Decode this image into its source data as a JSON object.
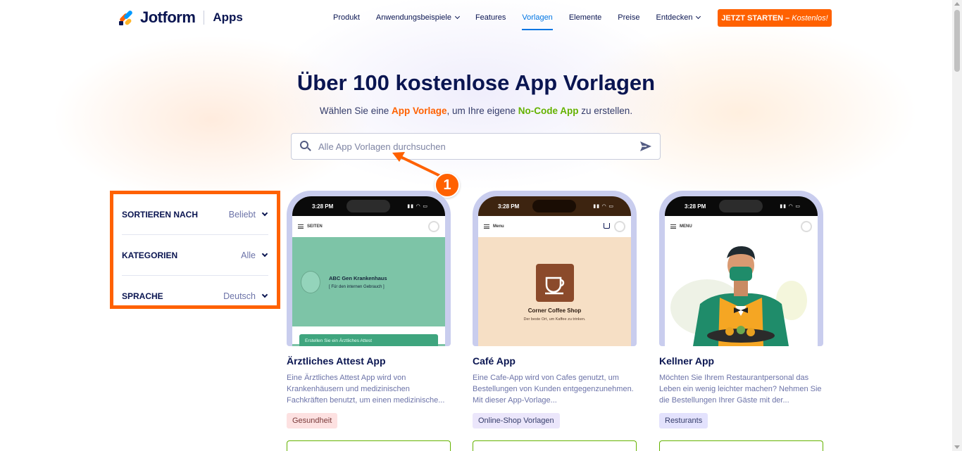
{
  "header": {
    "logo_text": "Jotform",
    "section": "Apps",
    "nav": [
      {
        "label": "Produkt",
        "dropdown": false,
        "active": false
      },
      {
        "label": "Anwendungsbeispiele",
        "dropdown": true,
        "active": false
      },
      {
        "label": "Features",
        "dropdown": false,
        "active": false
      },
      {
        "label": "Vorlagen",
        "dropdown": false,
        "active": true
      },
      {
        "label": "Elemente",
        "dropdown": false,
        "active": false
      },
      {
        "label": "Preise",
        "dropdown": false,
        "active": false
      },
      {
        "label": "Entdecken",
        "dropdown": true,
        "active": false
      }
    ],
    "cta_main": "JETZT STARTEN –",
    "cta_em": "Kostenlos!"
  },
  "hero": {
    "title": "Über 100 kostenlose App Vorlagen",
    "sub_pre": "Wählen Sie eine ",
    "sub_hl1": "App Vorlage",
    "sub_mid": ", um Ihre eigene ",
    "sub_hl2": "No-Code App",
    "sub_post": " zu erstellen."
  },
  "search": {
    "placeholder": "Alle App Vorlagen durchsuchen",
    "value": ""
  },
  "annotation": {
    "number": "1"
  },
  "filters": [
    {
      "label": "SORTIEREN NACH",
      "value": "Beliebt"
    },
    {
      "label": "KATEGORIEN",
      "value": "Alle"
    },
    {
      "label": "SPRACHE",
      "value": "Deutsch"
    }
  ],
  "cards": [
    {
      "title": "Ärztliches Attest App",
      "description": "Eine Ärztliches Attest App wird von Krankenhäusern und medizinischen Fachkräften benutzt, um einen medizinische...",
      "tag": "Gesundheit",
      "tag_bg": "#fde1e1",
      "tag_color": "#7a3a3a",
      "phone": {
        "time": "3:28 PM",
        "appbar_label": "SEITEN",
        "hero_title": "ABC Gen Krankenhaus",
        "hero_sub": "[ Für den internen Gebrauch ]",
        "hero_button": "Erstellen Sie ein Ärztliches Attest",
        "hero_bg": "#7dc4a7",
        "statusbar_bg": "#0a0a0a"
      }
    },
    {
      "title": "Café App",
      "description": "Eine Cafe-App wird von Cafes genutzt, um Bestellungen von Kunden entgegenzunehmen. Mit dieser App-Vorlage...",
      "tag": "Online-Shop Vorlagen",
      "tag_bg": "#ebe6fb",
      "tag_color": "#343c6a",
      "phone": {
        "time": "3:28 PM",
        "appbar_label": "Menu",
        "hero_title": "Corner Coffee Shop",
        "hero_sub": "Der beste Ort, um Kaffee zu trinken.",
        "hero_bg": "#f6dfc5",
        "statusbar_bg": "#3d2410"
      }
    },
    {
      "title": "Kellner App",
      "description": "Möchten Sie Ihrem Restaurantpersonal das Leben ein wenig leichter machen? Nehmen Sie die Bestellungen Ihrer Gäste mit der...",
      "tag": "Resturants",
      "tag_bg": "#e3e2fd",
      "tag_color": "#343c6a",
      "phone": {
        "time": "3:28 PM",
        "appbar_label": "MENU",
        "hero_bg": "#ffffff",
        "statusbar_bg": "#0a0a0a"
      }
    }
  ],
  "colors": {
    "brand_orange": "#ff6100",
    "brand_navy": "#0a1551",
    "nav_active": "#0075e3",
    "green": "#64b200"
  }
}
